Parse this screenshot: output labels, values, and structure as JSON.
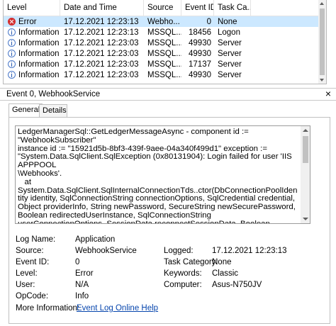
{
  "columns": [
    "Level",
    "Date and Time",
    "Source",
    "Event ID",
    "Task Ca..."
  ],
  "rows": [
    {
      "level": "Error",
      "icon": "error-icon",
      "date": "17.12.2021 12:23:13",
      "source": "Webho...",
      "event_id": "0",
      "task": "None",
      "selected": true
    },
    {
      "level": "Information",
      "icon": "info-icon",
      "date": "17.12.2021 12:23:13",
      "source": "MSSQL...",
      "event_id": "18456",
      "task": "Logon",
      "selected": false
    },
    {
      "level": "Information",
      "icon": "info-icon",
      "date": "17.12.2021 12:23:03",
      "source": "MSSQL...",
      "event_id": "49930",
      "task": "Server",
      "selected": false
    },
    {
      "level": "Information",
      "icon": "info-icon",
      "date": "17.12.2021 12:23:03",
      "source": "MSSQL...",
      "event_id": "49930",
      "task": "Server",
      "selected": false
    },
    {
      "level": "Information",
      "icon": "info-icon",
      "date": "17.12.2021 12:23:03",
      "source": "MSSQL...",
      "event_id": "17137",
      "task": "Server",
      "selected": false
    },
    {
      "level": "Information",
      "icon": "info-icon",
      "date": "17.12.2021 12:23:03",
      "source": "MSSQL...",
      "event_id": "49930",
      "task": "Server",
      "selected": false
    }
  ],
  "details": {
    "title": "Event 0, WebhookService",
    "close_glyph": "×",
    "tabs": {
      "general": "General",
      "details": "Details"
    },
    "description": "LedgerManagerSql::GetLedgerMessageAsync - component id := \"WebhookSubscriber\"\ninstance id := \"15921d5b-8bf3-439f-9aee-04a340f499d1\" exception :=\n\"System.Data.SqlClient.SqlException (0x80131904): Login failed for user 'IIS APPPOOL\n\\Webhooks'.\n   at System.Data.SqlClient.SqlInternalConnectionTds..ctor(DbConnectionPoolIdentity identity, SqlConnectionString connectionOptions, SqlCredential credential, Object providerInfo, String newPassword, SecureString newSecurePassword, Boolean redirectedUserInstance, SqlConnectionString userConnectionOptions, SessionData reconnectSessionData, Boolean applyTransientFaultHandling, String accessToken)\n   at System.Data.SqlClient.SqlConnectionFactory.CreateConnection(DbConnectionOptions options, DbConnectionPoolKey poolKey, Object poolGroupProviderInfo, DbConnectionPool pool, DbConnection owningConnection, DbConnectionOptions userOptions)",
    "fields": {
      "log_name_label": "Log Name:",
      "log_name": "Application",
      "source_label": "Source:",
      "source": "WebhookService",
      "logged_label": "Logged:",
      "logged": "17.12.2021 12:23:13",
      "event_id_label": "Event ID:",
      "event_id": "0",
      "task_category_label": "Task Category:",
      "task_category": "None",
      "level_label": "Level:",
      "level": "Error",
      "keywords_label": "Keywords:",
      "keywords": "Classic",
      "user_label": "User:",
      "user": "N/A",
      "computer_label": "Computer:",
      "computer": "Asus-N750JV",
      "opcode_label": "OpCode:",
      "opcode": "Info",
      "more_info_label": "More Information:",
      "more_info_link": "Event Log Online Help"
    }
  }
}
